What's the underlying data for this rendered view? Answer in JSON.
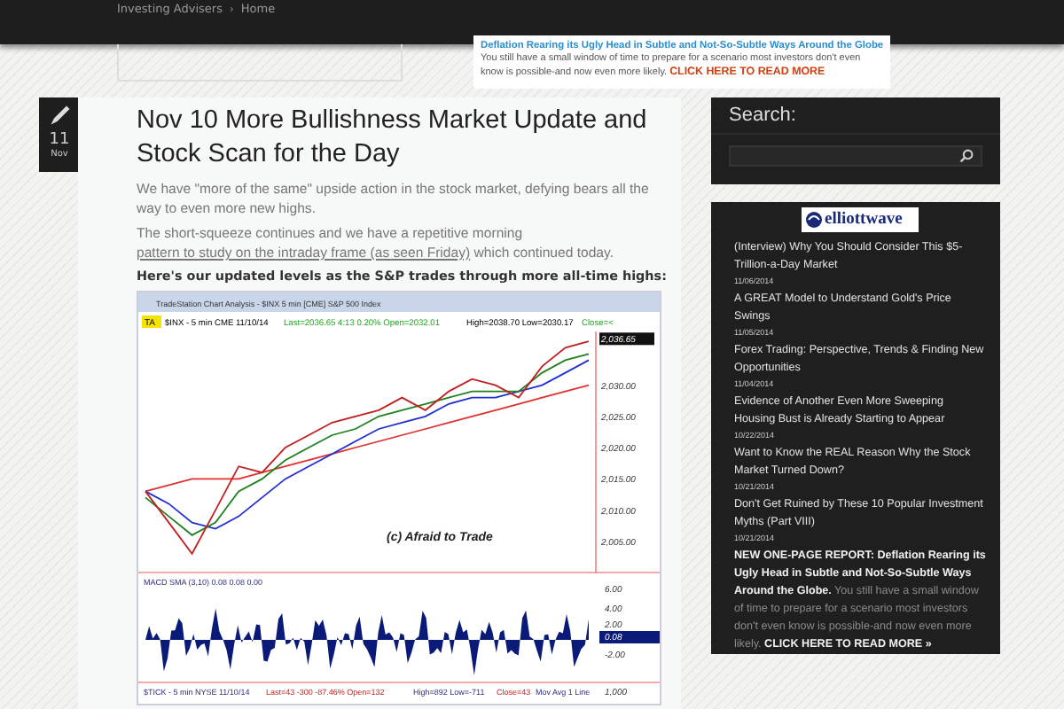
{
  "breadcrumb": [
    "Investing Advisers",
    "Home"
  ],
  "breadcrumb_sep": "›",
  "banner": {
    "headline": "Deflation Rearing its Ugly Head in Subtle and Not-So-Subtle Ways Around the Globe",
    "text": "You still have a small window of time to prepare for a scenario most investors don't even know is possible-and now even more likely.",
    "cta": "CLICK HERE TO READ MORE"
  },
  "post": {
    "day": "11",
    "month": "Nov",
    "title": "Nov 10 More Bullishness Market Update and Stock Scan for the Day",
    "paragraphs": [
      "We have \"more of the same\" upside action in the stock market, defying bears all the way to even more new highs."
    ],
    "paragraph2": {
      "before": "The short-squeeze continues and we have a repetitive morning ",
      "link": "pattern to study on the intraday frame (as seen Friday)",
      "after": " which continued today."
    },
    "lead": "Here's our updated levels as the S&P trades through more all-time highs:",
    "chart": {
      "title": "TradeStation Chart Analysis - $INX 5 min [CME] S&P 500 Index",
      "tag": "TA",
      "info": "$INX - 5 min  CME  11/10/14",
      "quote": "Last=2036.65  4:13  0.20%  Open=2032.01",
      "hilo": "High=2038.70  Low=2030.17",
      "close": "Close=<",
      "last_price": "2,036.65",
      "chart_data": {
        "type": "line",
        "ylim": [
          2000,
          2038.6
        ],
        "yticks": [
          {
            "value": 2030,
            "label": "2,030.00"
          },
          {
            "value": 2025,
            "label": "2,025.00"
          },
          {
            "value": 2020,
            "label": "2,020.00"
          },
          {
            "value": 2015,
            "label": "2,015.00"
          },
          {
            "value": 2010,
            "label": "2,010.00"
          },
          {
            "value": 2005,
            "label": "2,005.00"
          }
        ],
        "series": [
          {
            "color": "#c02020",
            "values": [
              2013,
              2008,
              2003,
              2010,
              2017,
              2016,
              2020,
              2022,
              2024,
              2025,
              2026,
              2028,
              2026,
              2029,
              2031,
              2030,
              2028,
              2033,
              2036,
              2037
            ]
          },
          {
            "color": "#208020",
            "values": [
              2012,
              2009,
              2006,
              2008,
              2013,
              2015,
              2018,
              2020,
              2022,
              2023,
              2025,
              2026,
              2027,
              2028,
              2029,
              2029,
              2029,
              2032,
              2034,
              2035
            ]
          },
          {
            "color": "#2030d0",
            "values": [
              2013,
              2011,
              2008,
              2007,
              2009,
              2012,
              2015,
              2017,
              2019,
              2021,
              2023,
              2024,
              2025,
              2027,
              2028,
              2028,
              2029,
              2030,
              2032,
              2034
            ]
          },
          {
            "color": "#e03030",
            "values": [
              2013,
              2014,
              2015,
              2015,
              2015,
              2016,
              2017,
              2018,
              2019,
              2020,
              2021,
              2022,
              2023,
              2024,
              2025,
              2026,
              2027,
              2028,
              2029,
              2030
            ]
          }
        ]
      },
      "watermark": "(c) Afraid to Trade",
      "macd": "MACD SMA (3,10)  0.08  0.08  0.00",
      "macd_labels": [
        "6.00",
        "4.00",
        "2.00",
        "0.08",
        "-2.00"
      ],
      "tick_info": "$TICK - 5 min  NYSE  11/10/14",
      "tick_quote": "Last=43  -300  -87.46%  Open=132",
      "tick_hilo": "High=892  Low=-711",
      "tick_close": "Close=43",
      "tick_avg": "Mov Avg 1 Line",
      "tick_label": "1,000"
    }
  },
  "search": {
    "title": "Search:"
  },
  "feed": {
    "logo": "elliottwave",
    "items": [
      {
        "title": "(Interview) Why You Should Consider This $5-Trillion-a-Day Market",
        "date": "11/06/2014"
      },
      {
        "title": "A GREAT Model to Understand Gold's Price Swings",
        "date": "11/05/2014"
      },
      {
        "title": "Forex Trading: Perspective, Trends & Finding New Opportunities",
        "date": "11/04/2014"
      },
      {
        "title": "Evidence of Another Even More Sweeping Housing Bust is Already Starting to Appear",
        "date": "10/22/2014"
      },
      {
        "title": "Want to Know the REAL Reason Why the Stock Market Turned Down?",
        "date": "10/21/2014"
      },
      {
        "title": "Don't Get Ruined by These 10 Popular Investment Myths (Part VIII)",
        "date": "10/21/2014"
      }
    ],
    "promo": "**NEW ONE-PAGE REPORT: Deflation Rearing its Ugly Head in Subtle and Not-So-Subtle Ways Around the Globe.** You still have a small window of time to prepare for a scenario most investors don't even know is possible-and now even more likely. **CLICK HERE TO READ MORE »**"
  }
}
